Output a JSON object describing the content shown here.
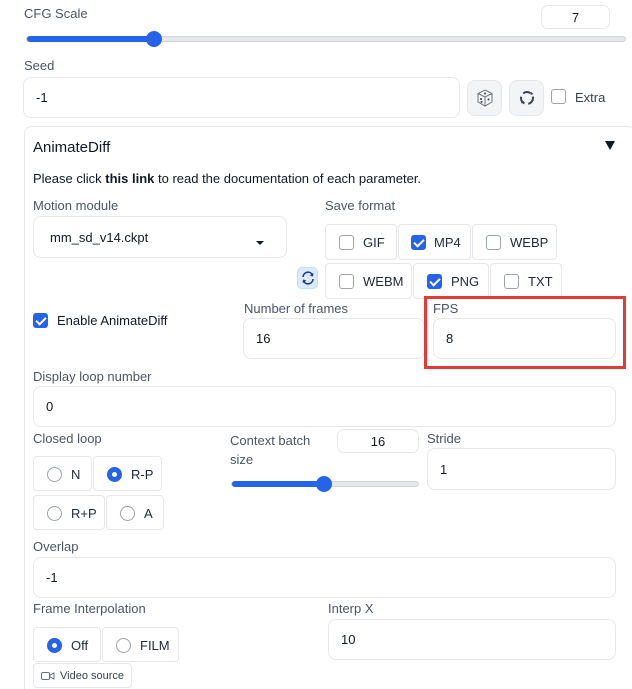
{
  "cfg": {
    "label": "CFG Scale",
    "value": "7",
    "fraction": 0.245
  },
  "seed": {
    "label": "Seed",
    "value": "-1",
    "extra_label": "Extra",
    "dice_icon": "dice-icon",
    "recycle_icon": "recycle-icon"
  },
  "animatediff": {
    "title": "AnimateDiff",
    "collapse_icon": "triangle-down-icon",
    "doc_prefix": "Please click ",
    "doc_link": "this link",
    "doc_suffix": " to read the documentation of each parameter.",
    "motion_module": {
      "label": "Motion module",
      "value": "mm_sd_v14.ckpt"
    },
    "save_format": {
      "label": "Save format",
      "options": [
        {
          "label": "GIF",
          "checked": false
        },
        {
          "label": "MP4",
          "checked": true
        },
        {
          "label": "WEBP",
          "checked": false
        },
        {
          "label": "WEBM",
          "checked": false
        },
        {
          "label": "PNG",
          "checked": true
        },
        {
          "label": "TXT",
          "checked": false
        }
      ]
    },
    "enable_label": "Enable AnimateDiff",
    "frames": {
      "label": "Number of frames",
      "value": "16"
    },
    "fps": {
      "label": "FPS",
      "value": "8",
      "highlight_color": "#e53935"
    },
    "loop_number": {
      "label": "Display loop number",
      "value": "0"
    },
    "closed_loop": {
      "label": "Closed loop",
      "options": [
        "N",
        "R-P",
        "R+P",
        "A"
      ],
      "selected": "R-P"
    },
    "context_batch": {
      "label_line1": "Context batch",
      "label_line2": "size",
      "value": "16",
      "fraction": 0.49
    },
    "stride": {
      "label": "Stride",
      "value": "1"
    },
    "overlap": {
      "label": "Overlap",
      "value": "-1"
    },
    "frame_interp": {
      "label": "Frame Interpolation",
      "options": [
        "Off",
        "FILM"
      ],
      "selected": "Off"
    },
    "interp_x": {
      "label": "Interp X",
      "value": "10"
    },
    "video_source": {
      "label": "Video source",
      "icon": "video-camera-icon"
    }
  },
  "colors": {
    "accent": "#2563eb",
    "highlight": "#e53935",
    "border": "#e5e7eb"
  }
}
